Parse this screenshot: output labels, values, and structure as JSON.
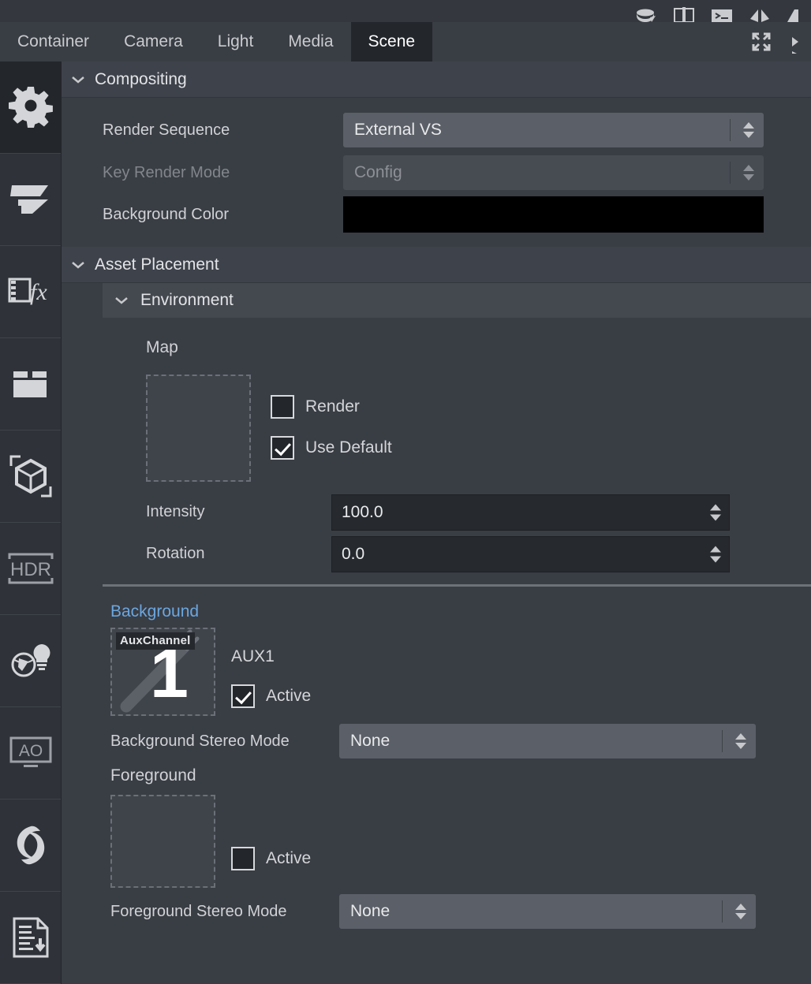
{
  "window": {
    "top_icons": [
      {
        "name": "render-queue-icon"
      },
      {
        "name": "book-icon"
      },
      {
        "name": "script-editor-icon"
      },
      {
        "name": "mirror-icon"
      },
      {
        "name": "partial-icon"
      }
    ]
  },
  "tabs": {
    "items": [
      {
        "label": "Container",
        "active": false
      },
      {
        "label": "Camera",
        "active": false
      },
      {
        "label": "Light",
        "active": false
      },
      {
        "label": "Media",
        "active": false
      },
      {
        "label": "Scene",
        "active": true
      }
    ],
    "right_icons": [
      {
        "name": "expand-icon"
      },
      {
        "name": "mirror-partial-icon"
      }
    ]
  },
  "rail": {
    "items": [
      {
        "name": "settings-gear-icon",
        "active": true
      },
      {
        "name": "shading-icon",
        "active": false
      },
      {
        "name": "film-effects-icon",
        "active": false
      },
      {
        "name": "studio-backdrop-icon",
        "active": false
      },
      {
        "name": "object-bounds-icon",
        "active": false
      },
      {
        "name": "hdr-icon",
        "label": "HDR",
        "active": false
      },
      {
        "name": "global-light-icon",
        "active": false
      },
      {
        "name": "ambient-occlusion-icon",
        "label": "AO",
        "active": false
      },
      {
        "name": "motion-blur-icon",
        "active": false
      },
      {
        "name": "document-export-icon",
        "active": false
      }
    ]
  },
  "compositing": {
    "title": "Compositing",
    "render_sequence": {
      "label": "Render Sequence",
      "value": "External VS",
      "enabled": true
    },
    "key_render_mode": {
      "label": "Key Render Mode",
      "value": "Config",
      "enabled": false
    },
    "background_color": {
      "label": "Background Color",
      "value": "#000000"
    }
  },
  "asset_placement": {
    "title": "Asset Placement",
    "environment": {
      "title": "Environment",
      "map": {
        "label": "Map",
        "render": {
          "label": "Render",
          "checked": false
        },
        "use_default": {
          "label": "Use Default",
          "checked": true
        }
      },
      "intensity": {
        "label": "Intensity",
        "value": "100.0"
      },
      "rotation": {
        "label": "Rotation",
        "value": "0.0"
      },
      "background": {
        "title": "Background",
        "thumb_badge": "AuxChannel",
        "thumb_number": "1",
        "source_name": "AUX1",
        "active": {
          "label": "Active",
          "checked": true
        },
        "stereo_mode": {
          "label": "Background Stereo Mode",
          "value": "None"
        }
      },
      "foreground": {
        "title": "Foreground",
        "active": {
          "label": "Active",
          "checked": false
        },
        "stereo_mode": {
          "label": "Foreground Stereo Mode",
          "value": "None"
        }
      }
    }
  }
}
